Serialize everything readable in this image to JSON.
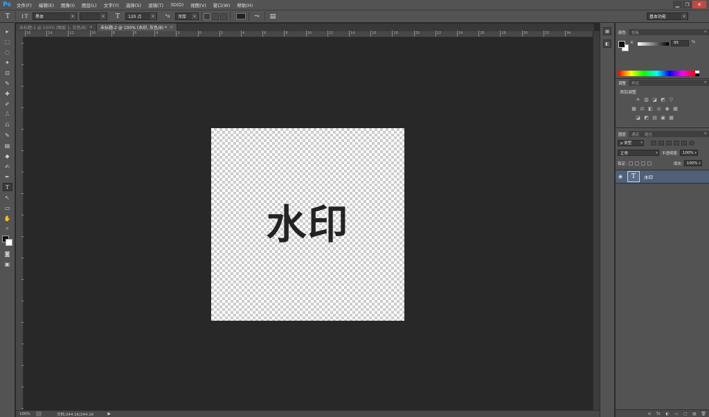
{
  "app": {
    "logo": "Ps"
  },
  "menu": [
    "文件(F)",
    "编辑(E)",
    "图像(I)",
    "图层(L)",
    "文字(Y)",
    "选择(S)",
    "滤镜(T)",
    "3D(D)",
    "视图(V)",
    "窗口(W)",
    "帮助(H)"
  ],
  "window_controls": {
    "minimize": "▁",
    "restore": "❐",
    "close": "✕"
  },
  "options": {
    "tool_icon": "T",
    "orient_icon": "↕T",
    "font_family": "黑体",
    "font_style": "",
    "size_icon": "T",
    "font_size": "120 点",
    "aa_icon": "ªa",
    "antialias": "浑厚",
    "workspace": "基本功能",
    "text_color": "#222222"
  },
  "tabs": [
    {
      "title": "未标题-1 @ 100% (图层 1, 灰色/8)",
      "close": "×"
    },
    {
      "title": "未标题-2 @ 100% (水印, 灰色/8) *",
      "close": "×"
    }
  ],
  "ruler": {
    "h_labels": [
      "16",
      "14",
      "12",
      "10",
      "8",
      "6",
      "4",
      "2",
      "0",
      "2",
      "4",
      "6",
      "8",
      "10",
      "12",
      "14",
      "16",
      "18",
      "20",
      "22",
      "24",
      "26",
      "28",
      "30",
      "32",
      "34"
    ]
  },
  "canvas": {
    "text": "水印",
    "transparent": true
  },
  "status": {
    "zoom": "100%",
    "doc_info": "文档:244.1K/244.1K",
    "arrow": "▶"
  },
  "panels": {
    "color": {
      "tabs": [
        "颜色",
        "色板"
      ],
      "channel_label": "K",
      "value": "95",
      "unit": "%",
      "foreground": "#111111",
      "background": "#ffffff"
    },
    "adjustments": {
      "tabs": [
        "调整",
        "样式"
      ],
      "title": "添加调整",
      "row1": [
        "☀",
        "▥",
        "◪",
        "◩",
        "▽"
      ],
      "row2": [
        "▦",
        "⚖",
        "◧",
        "◎",
        "◉",
        "▦"
      ],
      "row3": [
        "◪",
        "◩",
        "▤",
        "▣",
        "▦"
      ]
    },
    "layers": {
      "tabs": [
        "图层",
        "通道",
        "路径"
      ],
      "filter_kind": "ρ 类型",
      "blend_mode": "正常",
      "opacity_label": "不透明度:",
      "opacity": "100%",
      "lock_label": "锁定:",
      "fill_label": "填充:",
      "fill": "100%",
      "layer_name": "水印",
      "layer_thumb": "T",
      "eye": "◉",
      "bottom_icons": [
        "ɞ",
        "fx",
        "◐",
        "▭",
        "▢",
        "▤",
        "🗑"
      ]
    }
  },
  "tools": [
    "▸",
    "⬚",
    "◌",
    "✦",
    "⊡",
    "✎",
    "✚",
    "✐",
    "⎍",
    "⎌",
    "✎",
    "▤",
    "◆",
    "✍",
    "✒",
    "T",
    "↖",
    "▭",
    "✋",
    "⌕"
  ],
  "strip": [
    "▦",
    "◧"
  ]
}
